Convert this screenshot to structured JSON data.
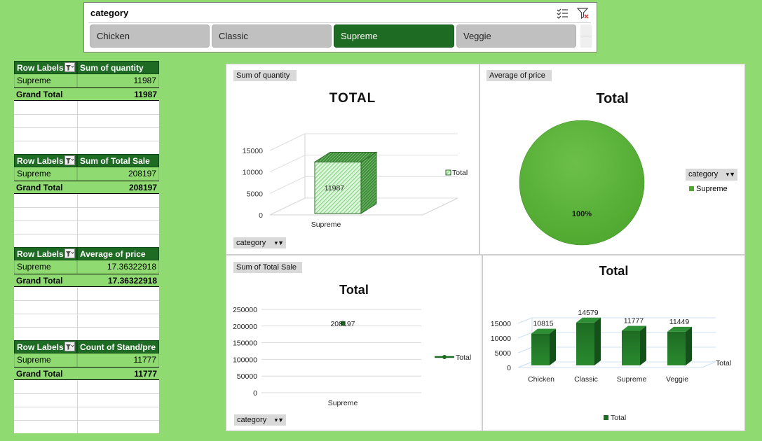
{
  "slicer": {
    "title": "category",
    "items": [
      {
        "label": "Chicken",
        "selected": false
      },
      {
        "label": "Classic",
        "selected": false
      },
      {
        "label": "Supreme",
        "selected": true
      },
      {
        "label": "Veggie",
        "selected": false
      }
    ],
    "selected_color": "#1e6b23"
  },
  "pivots": [
    {
      "header": [
        "Row Labels",
        "Sum of quantity"
      ],
      "rows": [
        [
          "Supreme",
          "11987"
        ]
      ],
      "total": [
        "Grand Total",
        "11987"
      ]
    },
    {
      "header": [
        "Row Labels",
        "Sum of Total Sale"
      ],
      "rows": [
        [
          "Supreme",
          "208197"
        ]
      ],
      "total": [
        "Grand Total",
        "208197"
      ]
    },
    {
      "header": [
        "Row Labels",
        "Average of price"
      ],
      "rows": [
        [
          "Supreme",
          "17.36322918"
        ]
      ],
      "total": [
        "Grand Total",
        "17.36322918"
      ]
    },
    {
      "header": [
        "Row Labels",
        "Count of Stand/pre"
      ],
      "rows": [
        [
          "Supreme",
          "11777"
        ]
      ],
      "total": [
        "Grand Total",
        "11777"
      ]
    }
  ],
  "charts": {
    "quantity": {
      "field_button": "Sum of quantity",
      "axis_button": "category",
      "title": "TOTAL",
      "legend": "Total"
    },
    "price": {
      "field_button": "Average of price",
      "title": "Total",
      "legend_field_button": "category",
      "legend": "Supreme",
      "slice_label": "100%"
    },
    "sale": {
      "field_button": "Sum of Total Sale",
      "axis_button": "category",
      "title": "Total",
      "legend": "Total"
    },
    "count": {
      "title": "Total",
      "legend": "Total",
      "depth_label": "Total"
    }
  },
  "chart_data": [
    {
      "type": "bar",
      "title": "TOTAL",
      "categories": [
        "Supreme"
      ],
      "series": [
        {
          "name": "Total",
          "values": [
            11987
          ]
        }
      ],
      "yticks": [
        "0",
        "5000",
        "10000",
        "15000"
      ],
      "ylim": [
        0,
        15000
      ],
      "data_labels": [
        "11987"
      ],
      "legend_position": "right",
      "color": "#7fd67f"
    },
    {
      "type": "pie",
      "title": "Total",
      "categories": [
        "Supreme"
      ],
      "values": [
        17.36322918
      ],
      "labels": [
        "100%"
      ],
      "legend_position": "right",
      "color": "#4ea72e"
    },
    {
      "type": "line",
      "title": "Total",
      "categories": [
        "Supreme"
      ],
      "series": [
        {
          "name": "Total",
          "values": [
            208197
          ]
        }
      ],
      "yticks": [
        "0",
        "50000",
        "100000",
        "150000",
        "200000",
        "250000"
      ],
      "ylim": [
        0,
        250000
      ],
      "data_labels": [
        "208197"
      ],
      "legend_position": "right",
      "grid": true,
      "color": "#1e6b23"
    },
    {
      "type": "bar",
      "title": "Total",
      "categories": [
        "Chicken",
        "Classic",
        "Supreme",
        "Veggie"
      ],
      "series": [
        {
          "name": "Total",
          "values": [
            10815,
            14579,
            11777,
            11449
          ]
        }
      ],
      "yticks": [
        "0",
        "5000",
        "10000",
        "15000"
      ],
      "ylim": [
        0,
        15000
      ],
      "data_labels": [
        "10815",
        "14579",
        "11777",
        "11449"
      ],
      "legend_position": "bottom",
      "color": "#1e6b23"
    }
  ]
}
